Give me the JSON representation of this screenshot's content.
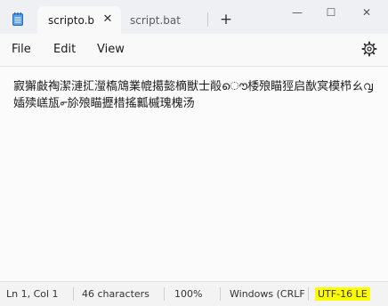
{
  "tabs": [
    {
      "label": "scripto.b",
      "active": true
    },
    {
      "label": "script.bat",
      "active": false
    }
  ],
  "window_controls": {
    "minimize": "—",
    "maximize": "☐",
    "close": "✕"
  },
  "new_tab_label": "+",
  "menu": {
    "file": "File",
    "edit": "Edit",
    "view": "View"
  },
  "editor": {
    "content": "㝮獬㪥祹潔漣㧟㶈槗鴧業㡙擖㦤樀獣士㲂ൌ㮃㱢瞄㹵启㷕㝠模栉ㄠ൮㛼㱩㟱瓬൳㫆㱢瞄攊棤搖瓤槭瑰槐汤"
  },
  "status": {
    "position": "Ln 1, Col 1",
    "characters": "46 characters",
    "zoom": "100%",
    "line_ending": "Windows (CRLF)",
    "encoding": "UTF-16 LE"
  },
  "colors": {
    "highlight": "#ffff00",
    "accent_icon": "#2b7bd6"
  }
}
